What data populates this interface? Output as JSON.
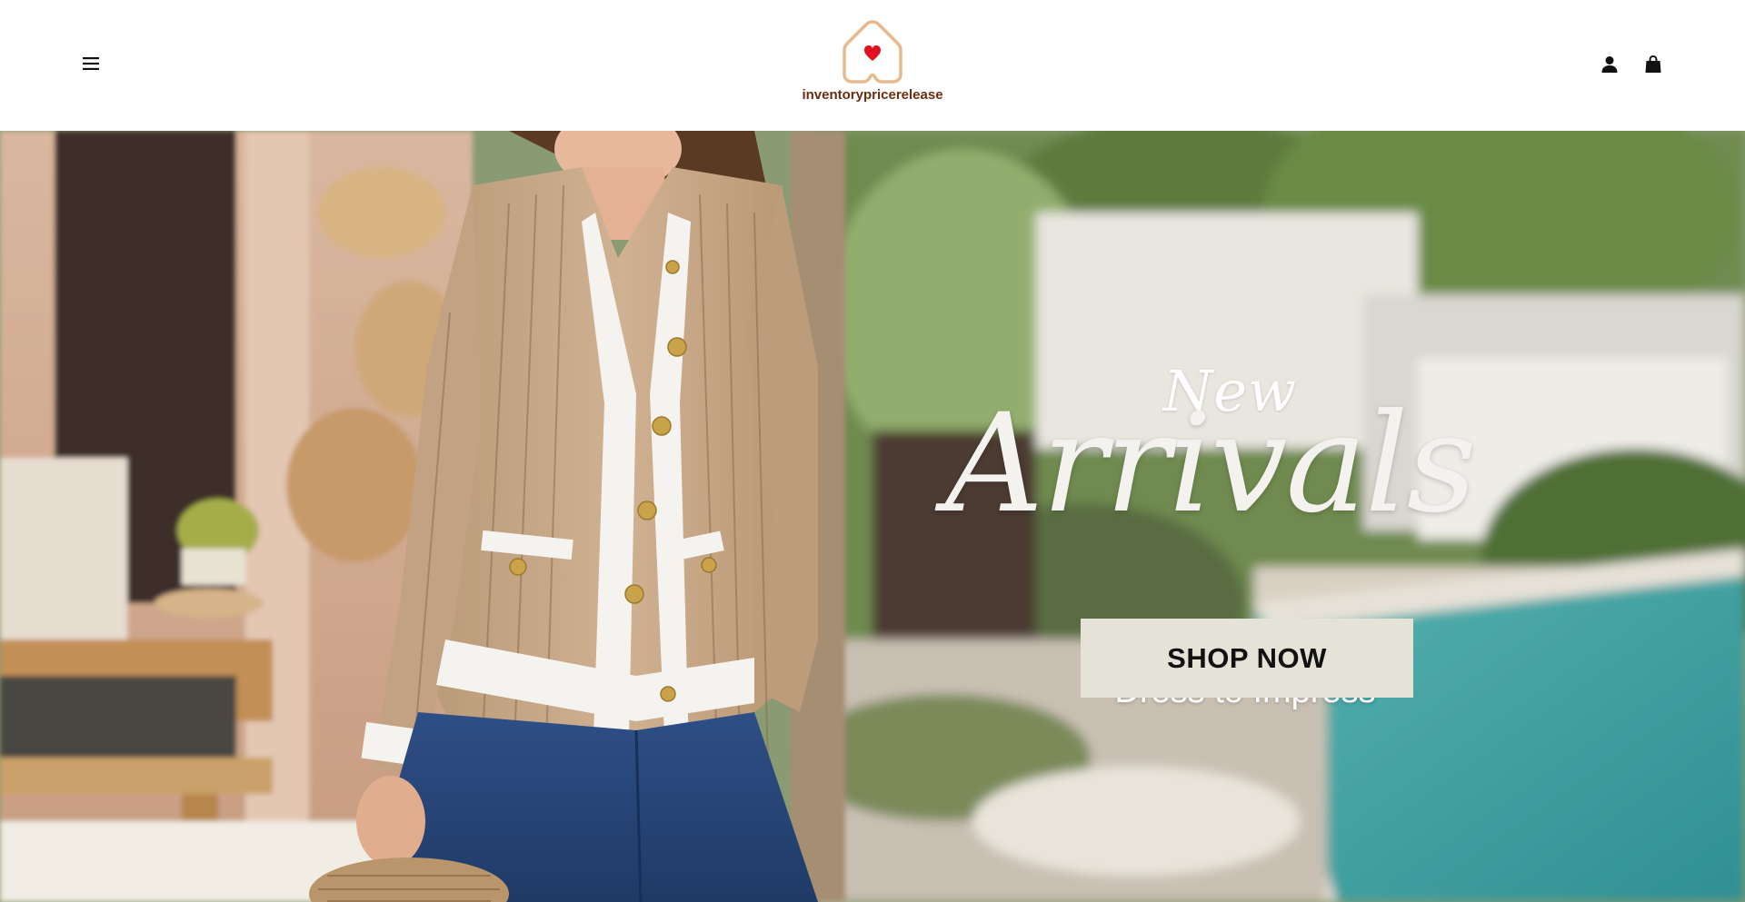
{
  "header": {
    "brand_name": "inventorypricerelease",
    "menu_icon": "hamburger-menu-icon",
    "account_icon": "user-icon",
    "cart_icon": "shopping-bag-icon"
  },
  "hero": {
    "headline_small": "New",
    "headline_large": "Arrivals",
    "subtitle": "Dress to Impress",
    "cta_label": "SHOP NOW"
  },
  "colors": {
    "brand_text": "#6b2c10",
    "logo_outline": "#e8b98e",
    "logo_heart": "#e0121f",
    "cta_background": "#e5e2d8",
    "cta_text": "#111111"
  }
}
